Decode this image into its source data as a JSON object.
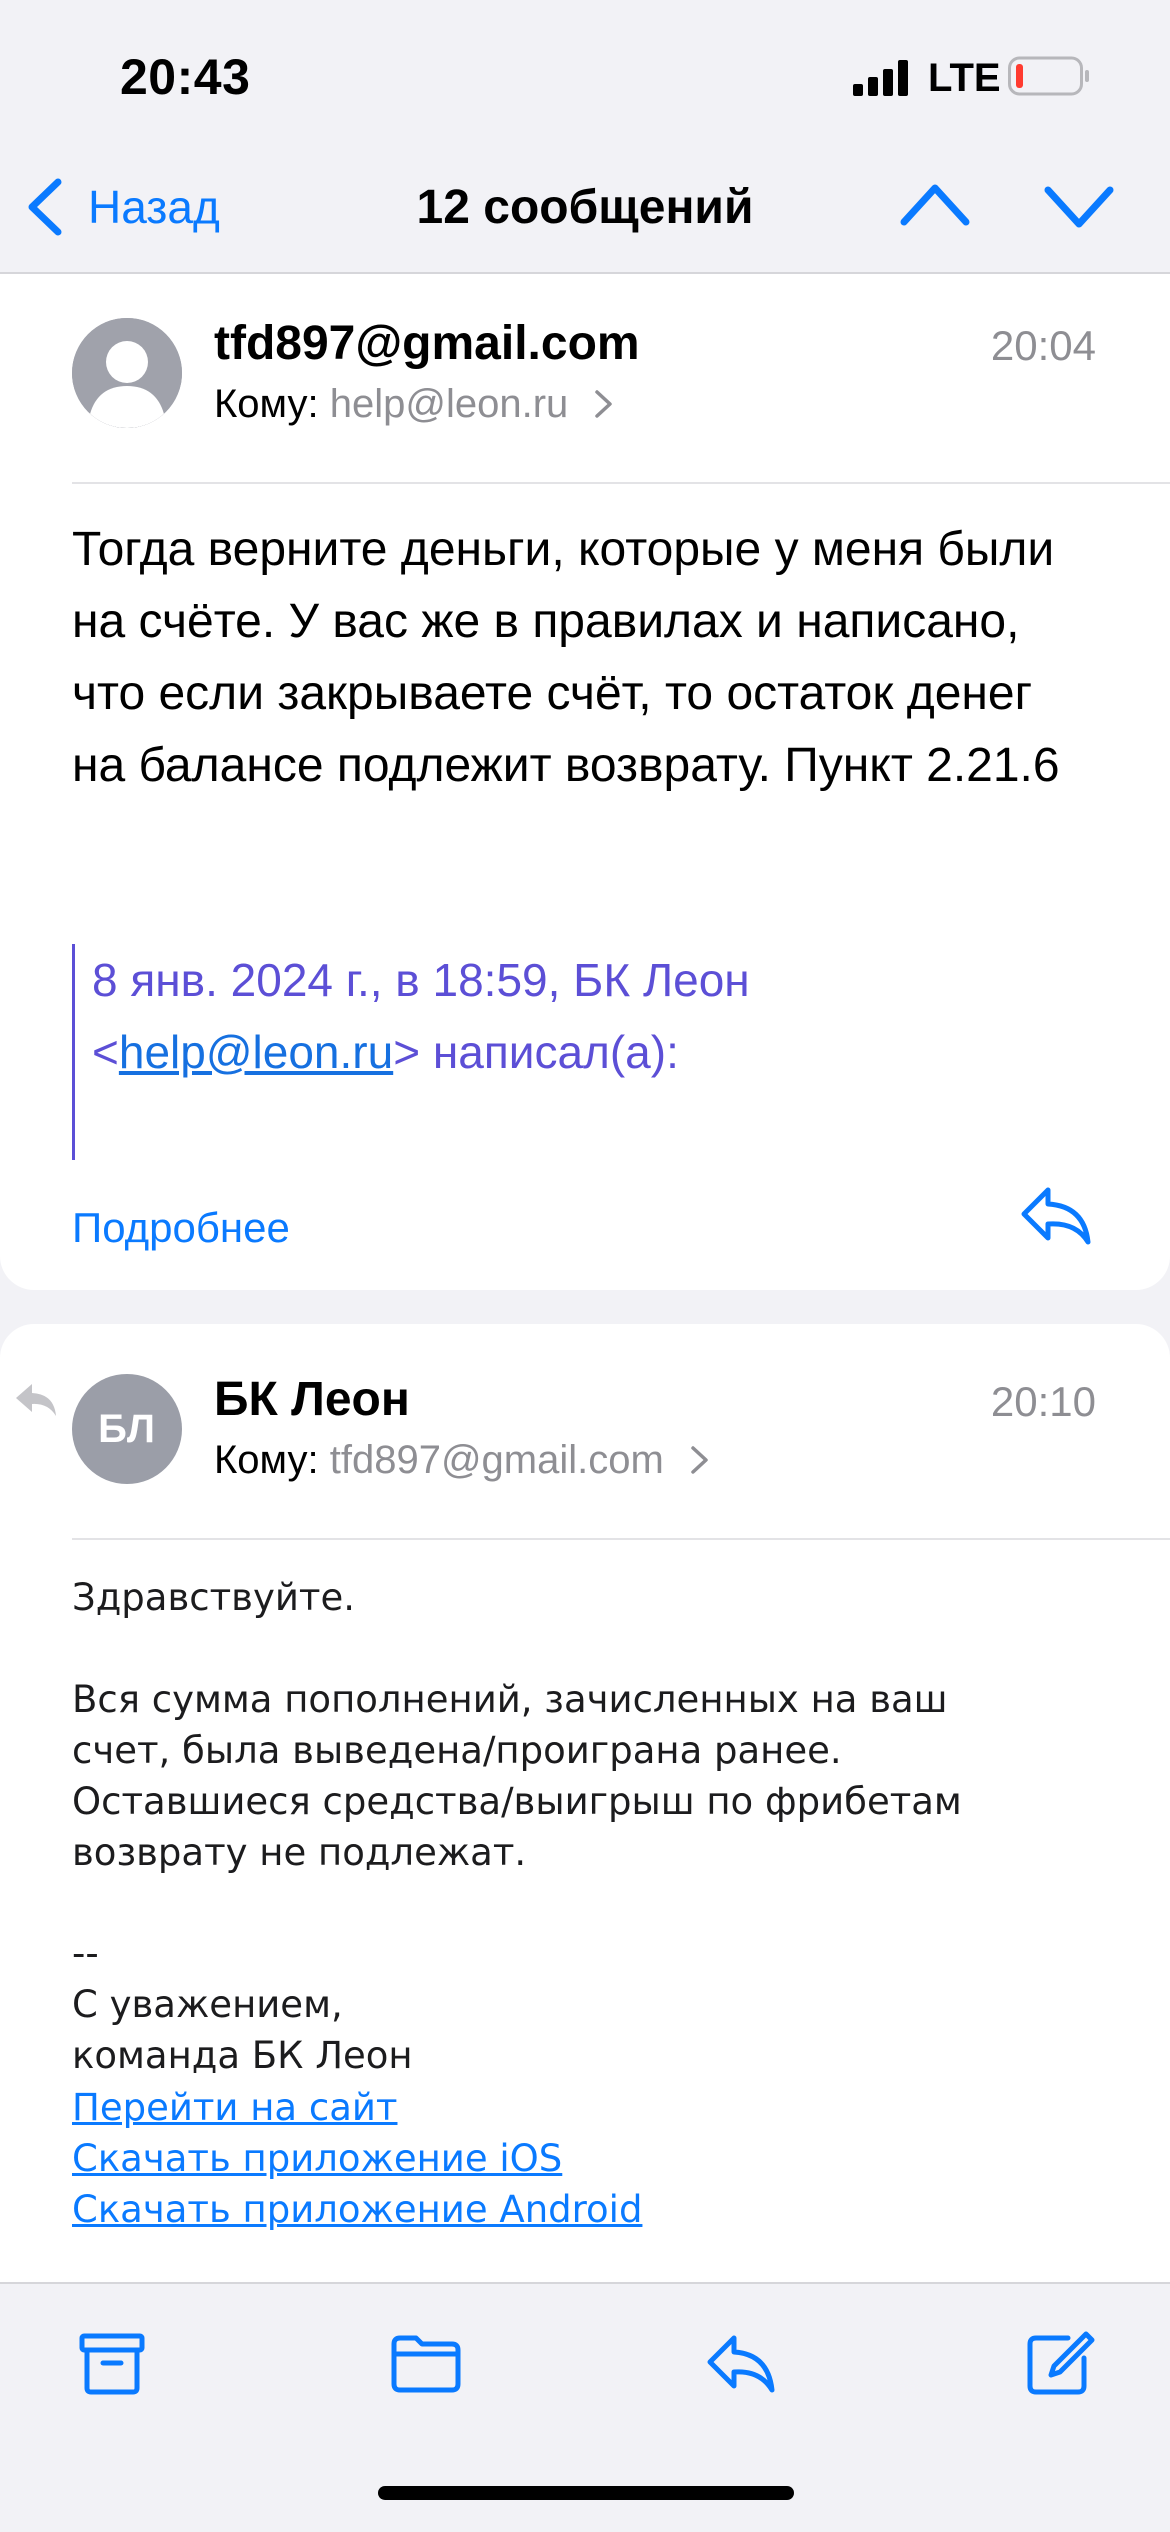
{
  "status_bar": {
    "time": "20:43",
    "network": "LTE",
    "battery_color": "#ff3b30"
  },
  "nav": {
    "back_label": "Назад",
    "title": "12 сообщений",
    "icons": [
      "chevron-left",
      "chevron-up",
      "chevron-down"
    ],
    "accent": "#0a7aff"
  },
  "message1": {
    "sender": "tfd897@gmail.com",
    "to_label": "Кому:",
    "to_address": "help@leon.ru",
    "time": "20:04",
    "body": "Тогда верните деньги, которые у меня были на счёте. У вас же в правилах и написано, что если закрываете счёт, то остаток денег на балансе подлежит возврату. Пункт 2.21.6",
    "quote_line1": "8 янв. 2024 г., в 18:59, БК Леон",
    "quote_prefix": "<",
    "quote_link": "help@leon.ru",
    "quote_suffix": "> написал(а):",
    "more_label": "Подробнее"
  },
  "message2": {
    "avatar_initials": "БЛ",
    "sender": "БК Леон",
    "to_label": "Кому:",
    "to_address": "tfd897@gmail.com",
    "time": "20:10",
    "greeting": "Здравствуйте.",
    "paragraph": "Вся сумма пополнений, зачисленных на ваш\nсчет, была выведена/проиграна ранее.\nОставшиеся средства/выигрыш по фрибетам\nвозврату не подлежат.",
    "signature": "--\nС уважением,\nкоманда БК Леон",
    "link_site": "Перейти на сайт",
    "link_ios": "Скачать приложение iOS",
    "link_android": "Скачать приложение Android"
  },
  "toolbar": {
    "icons": [
      "archive-icon",
      "folder-icon",
      "reply-icon",
      "compose-icon"
    ]
  }
}
